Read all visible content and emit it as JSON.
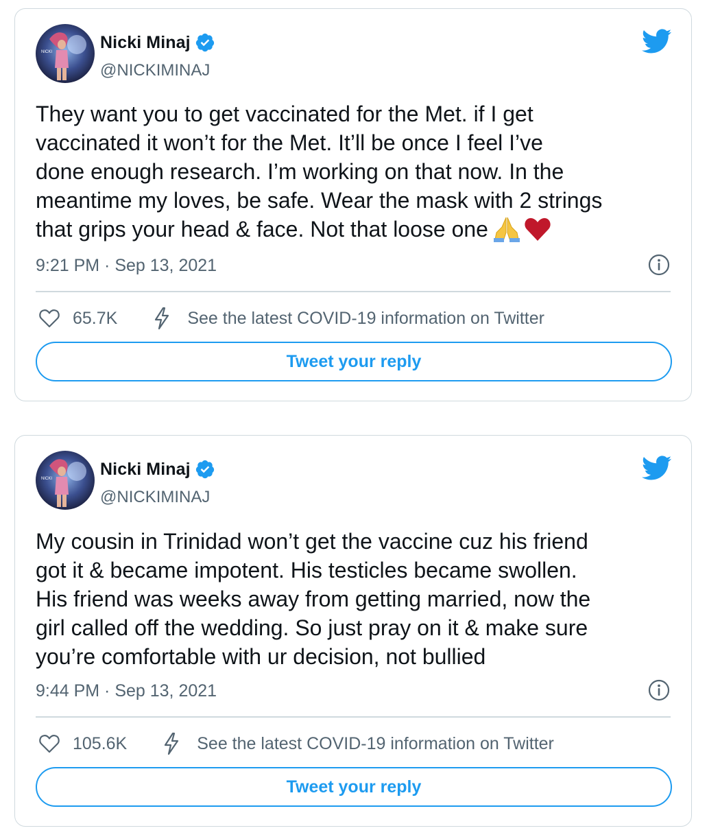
{
  "colors": {
    "accent": "#1d9bf0",
    "text_primary": "#0f1419",
    "text_secondary": "#536471",
    "border": "#cfd9de",
    "heart_emoji": "#c0182b",
    "hands_emoji": "#f5c542"
  },
  "icons": {
    "verified": "verified-badge-icon",
    "logo": "twitter-bird-icon",
    "info": "info-circle-icon",
    "like": "heart-outline-icon",
    "covid": "lightning-bolt-icon"
  },
  "tweets": [
    {
      "author_name": "Nicki Minaj",
      "author_handle": "@NICKIMINAJ",
      "text": "They want you to get vaccinated for the Met. if I get\nvaccinated it won’t for the Met. It’ll be once I feel I’ve\ndone enough research. I’m working on that now. In the\nmeantime my loves, be safe. Wear the mask with 2 strings\nthat grips your head & face. Not that loose one",
      "emojis": [
        "folded-hands-emoji",
        "red-heart-emoji"
      ],
      "timestamp": "9:21 PM · Sep 13, 2021",
      "likes": "65.7K",
      "covid_link": "See the latest COVID-19 information on Twitter",
      "reply_label": "Tweet your reply"
    },
    {
      "author_name": "Nicki Minaj",
      "author_handle": "@NICKIMINAJ",
      "text": "My cousin in Trinidad won’t get the vaccine cuz his friend\ngot it & became impotent. His testicles became swollen.\nHis friend was weeks away from getting married, now the\ngirl called off the wedding. So just pray on it & make sure\nyou’re comfortable with ur decision, not bullied",
      "timestamp": "9:44 PM · Sep 13, 2021",
      "likes": "105.6K",
      "covid_link": "See the latest COVID-19 information on Twitter",
      "reply_label": "Tweet your reply"
    }
  ]
}
